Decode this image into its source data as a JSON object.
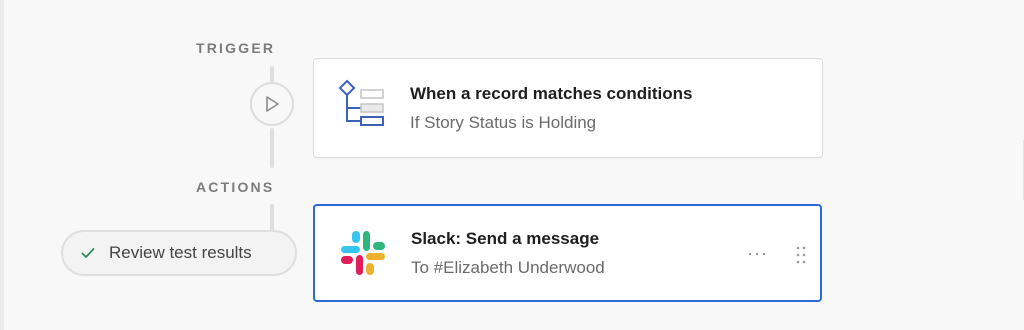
{
  "trigger_section": {
    "label": "TRIGGER",
    "card": {
      "title": "When a record matches conditions",
      "subtitle": "If Story Status is Holding",
      "icon": "conditions-tree-icon"
    },
    "play_icon": "play-icon"
  },
  "actions_section": {
    "label": "ACTIONS",
    "review": {
      "label": "Review test results",
      "icon": "check-icon"
    },
    "card": {
      "title": "Slack: Send a message",
      "subtitle": "To #Elizabeth Underwood",
      "icon": "slack-icon",
      "more_label": "···",
      "drag_icon": "drag-handle-icon"
    }
  },
  "colors": {
    "accent_border": "#2d6ad3",
    "icon_blue": "#3a63b8",
    "check_green": "#2e8b57"
  }
}
